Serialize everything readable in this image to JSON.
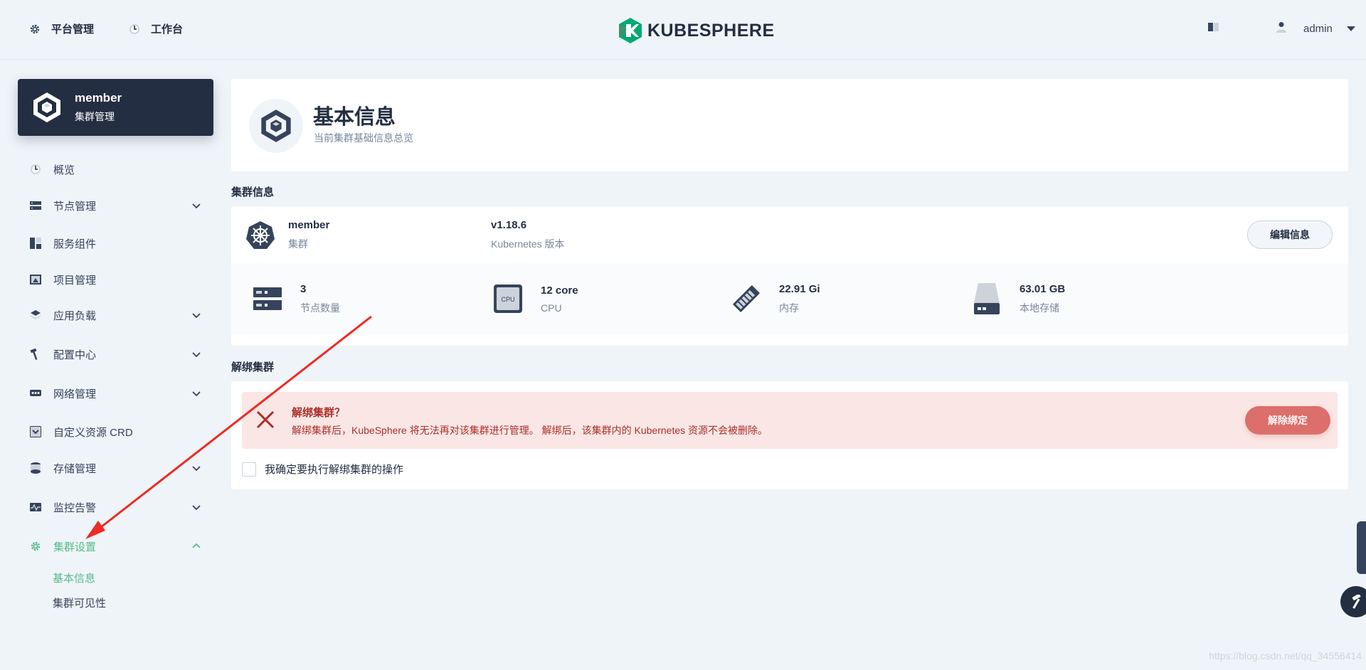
{
  "header": {
    "platform_label": "平台管理",
    "workbench_label": "工作台",
    "logo_text": "KUBESPHERE",
    "username": "admin"
  },
  "sidebar": {
    "cluster_name": "member",
    "cluster_subtitle": "集群管理",
    "items": [
      {
        "label": "概览",
        "icon": "dashboard-icon"
      },
      {
        "label": "节点管理",
        "icon": "nodes-icon",
        "expandable": true
      },
      {
        "label": "服务组件",
        "icon": "components-icon"
      },
      {
        "label": "项目管理",
        "icon": "project-icon"
      },
      {
        "label": "应用负载",
        "icon": "layers-icon",
        "expandable": true
      },
      {
        "label": "配置中心",
        "icon": "hammer-icon",
        "expandable": true
      },
      {
        "label": "网络管理",
        "icon": "network-icon",
        "expandable": true
      },
      {
        "label": "自定义资源 CRD",
        "icon": "crd-icon"
      },
      {
        "label": "存储管理",
        "icon": "storage-icon",
        "expandable": true
      },
      {
        "label": "监控告警",
        "icon": "monitor-icon",
        "expandable": true
      },
      {
        "label": "集群设置",
        "icon": "gear-icon",
        "expandable": true,
        "expanded": true,
        "active": true
      }
    ],
    "subitems": [
      {
        "label": "基本信息",
        "active": true
      },
      {
        "label": "集群可见性",
        "active": false
      }
    ]
  },
  "main": {
    "title": "基本信息",
    "subtitle": "当前集群基础信息总览",
    "cluster_info_heading": "集群信息",
    "cluster": {
      "name": "member",
      "name_label": "集群",
      "version": "v1.18.6",
      "version_label": "Kubernetes 版本",
      "edit_button": "编辑信息"
    },
    "stats": [
      {
        "value": "3",
        "label": "节点数量",
        "icon": "server-icon"
      },
      {
        "value": "12 core",
        "label": "CPU",
        "icon": "cpu-icon"
      },
      {
        "value": "22.91 Gi",
        "label": "内存",
        "icon": "memory-icon"
      },
      {
        "value": "63.01 GB",
        "label": "本地存储",
        "icon": "disk-icon"
      }
    ],
    "unbind_heading": "解绑集群",
    "unbind": {
      "alert_title": "解绑集群？",
      "alert_desc": "解绑集群后，KubeSphere 将无法再对该集群进行管理。 解绑后，该集群内的 Kubernetes 资源不会被删除。",
      "button": "解除绑定",
      "confirm_label": "我确定要执行解绑集群的操作"
    }
  },
  "watermark": "https://blog.csdn.net/qq_34556414",
  "colors": {
    "accent": "#55bc8a",
    "dark": "#242e42",
    "danger": "#ca2621",
    "annotation_arrow": "#ee2a24"
  }
}
